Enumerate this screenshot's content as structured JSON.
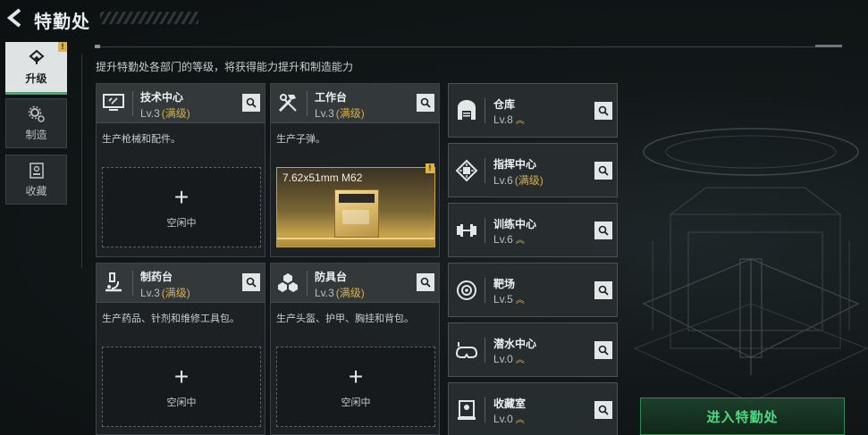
{
  "header": {
    "title": "特勤处",
    "subtitle": "提升特勤处各部门的等级，将获得能力提升和制造能力"
  },
  "tabs": [
    {
      "label": "升级",
      "icon": "upgrade-icon",
      "active": true,
      "alert": "!"
    },
    {
      "label": "制造",
      "icon": "gear-icon",
      "active": false
    },
    {
      "label": "收藏",
      "icon": "collection-icon",
      "active": false
    }
  ],
  "stations": [
    {
      "name": "技术中心",
      "level": "Lv.3",
      "max": "(满级)",
      "desc": "生产枪械和配件。",
      "icon": "monitor-icon",
      "slot_label": "空闲中"
    },
    {
      "name": "工作台",
      "level": "Lv.3",
      "max": "(满级)",
      "desc": "生产子弹。",
      "icon": "tools-icon",
      "crafting_item": "7.62x51mm M62",
      "alert": "!"
    },
    {
      "name": "制药台",
      "level": "Lv.3",
      "max": "(满级)",
      "desc": "生产药品、针剂和维修工具包。",
      "icon": "microscope-icon",
      "slot_label": "空闲中"
    },
    {
      "name": "防具台",
      "level": "Lv.3",
      "max": "(满级)",
      "desc": "生产头盔、护甲、胸挂和背包。",
      "icon": "cubes-icon",
      "slot_label": "空闲中"
    }
  ],
  "facilities": [
    {
      "name": "仓库",
      "level": "Lv.8",
      "max": "",
      "upgradable": true,
      "icon": "warehouse-icon"
    },
    {
      "name": "指挥中心",
      "level": "Lv.6",
      "max": "(满级)",
      "upgradable": false,
      "icon": "chip-icon"
    },
    {
      "name": "训练中心",
      "level": "Lv.6",
      "max": "",
      "upgradable": true,
      "icon": "dumbbell-icon"
    },
    {
      "name": "靶场",
      "level": "Lv.5",
      "max": "",
      "upgradable": true,
      "icon": "target-icon"
    },
    {
      "name": "潜水中心",
      "level": "Lv.0",
      "max": "",
      "upgradable": true,
      "icon": "goggles-icon"
    },
    {
      "name": "收藏室",
      "level": "Lv.0",
      "max": "",
      "upgradable": true,
      "icon": "display-case-icon"
    }
  ],
  "enter_button": "进入特勤处",
  "colors": {
    "accent_green": "#36b16a",
    "max_gold": "#d9b04a",
    "alert_yellow": "#e3b43a"
  }
}
